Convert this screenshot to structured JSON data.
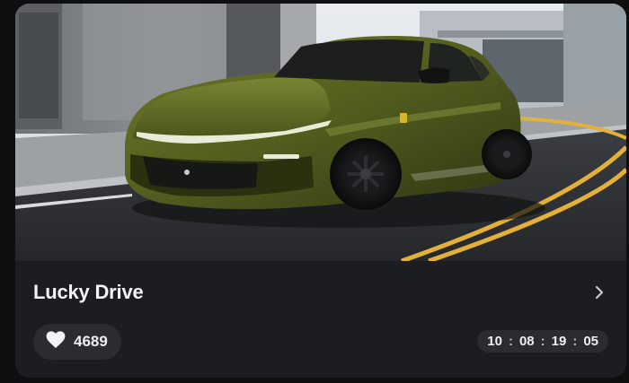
{
  "card": {
    "title": "Lucky Drive",
    "likes": "4689",
    "timer": {
      "hours": "10",
      "minutes": "08",
      "seconds": "19",
      "frames": "05",
      "separator": ":"
    }
  },
  "icons": {
    "like": "heart-icon",
    "open": "chevron-right-icon"
  },
  "colors": {
    "card_bg": "#1c1d20",
    "pill_bg": "#2b2c30",
    "text": "#f2f3f5",
    "car_body": "#5a6422",
    "road_line": "#e3b13a"
  }
}
